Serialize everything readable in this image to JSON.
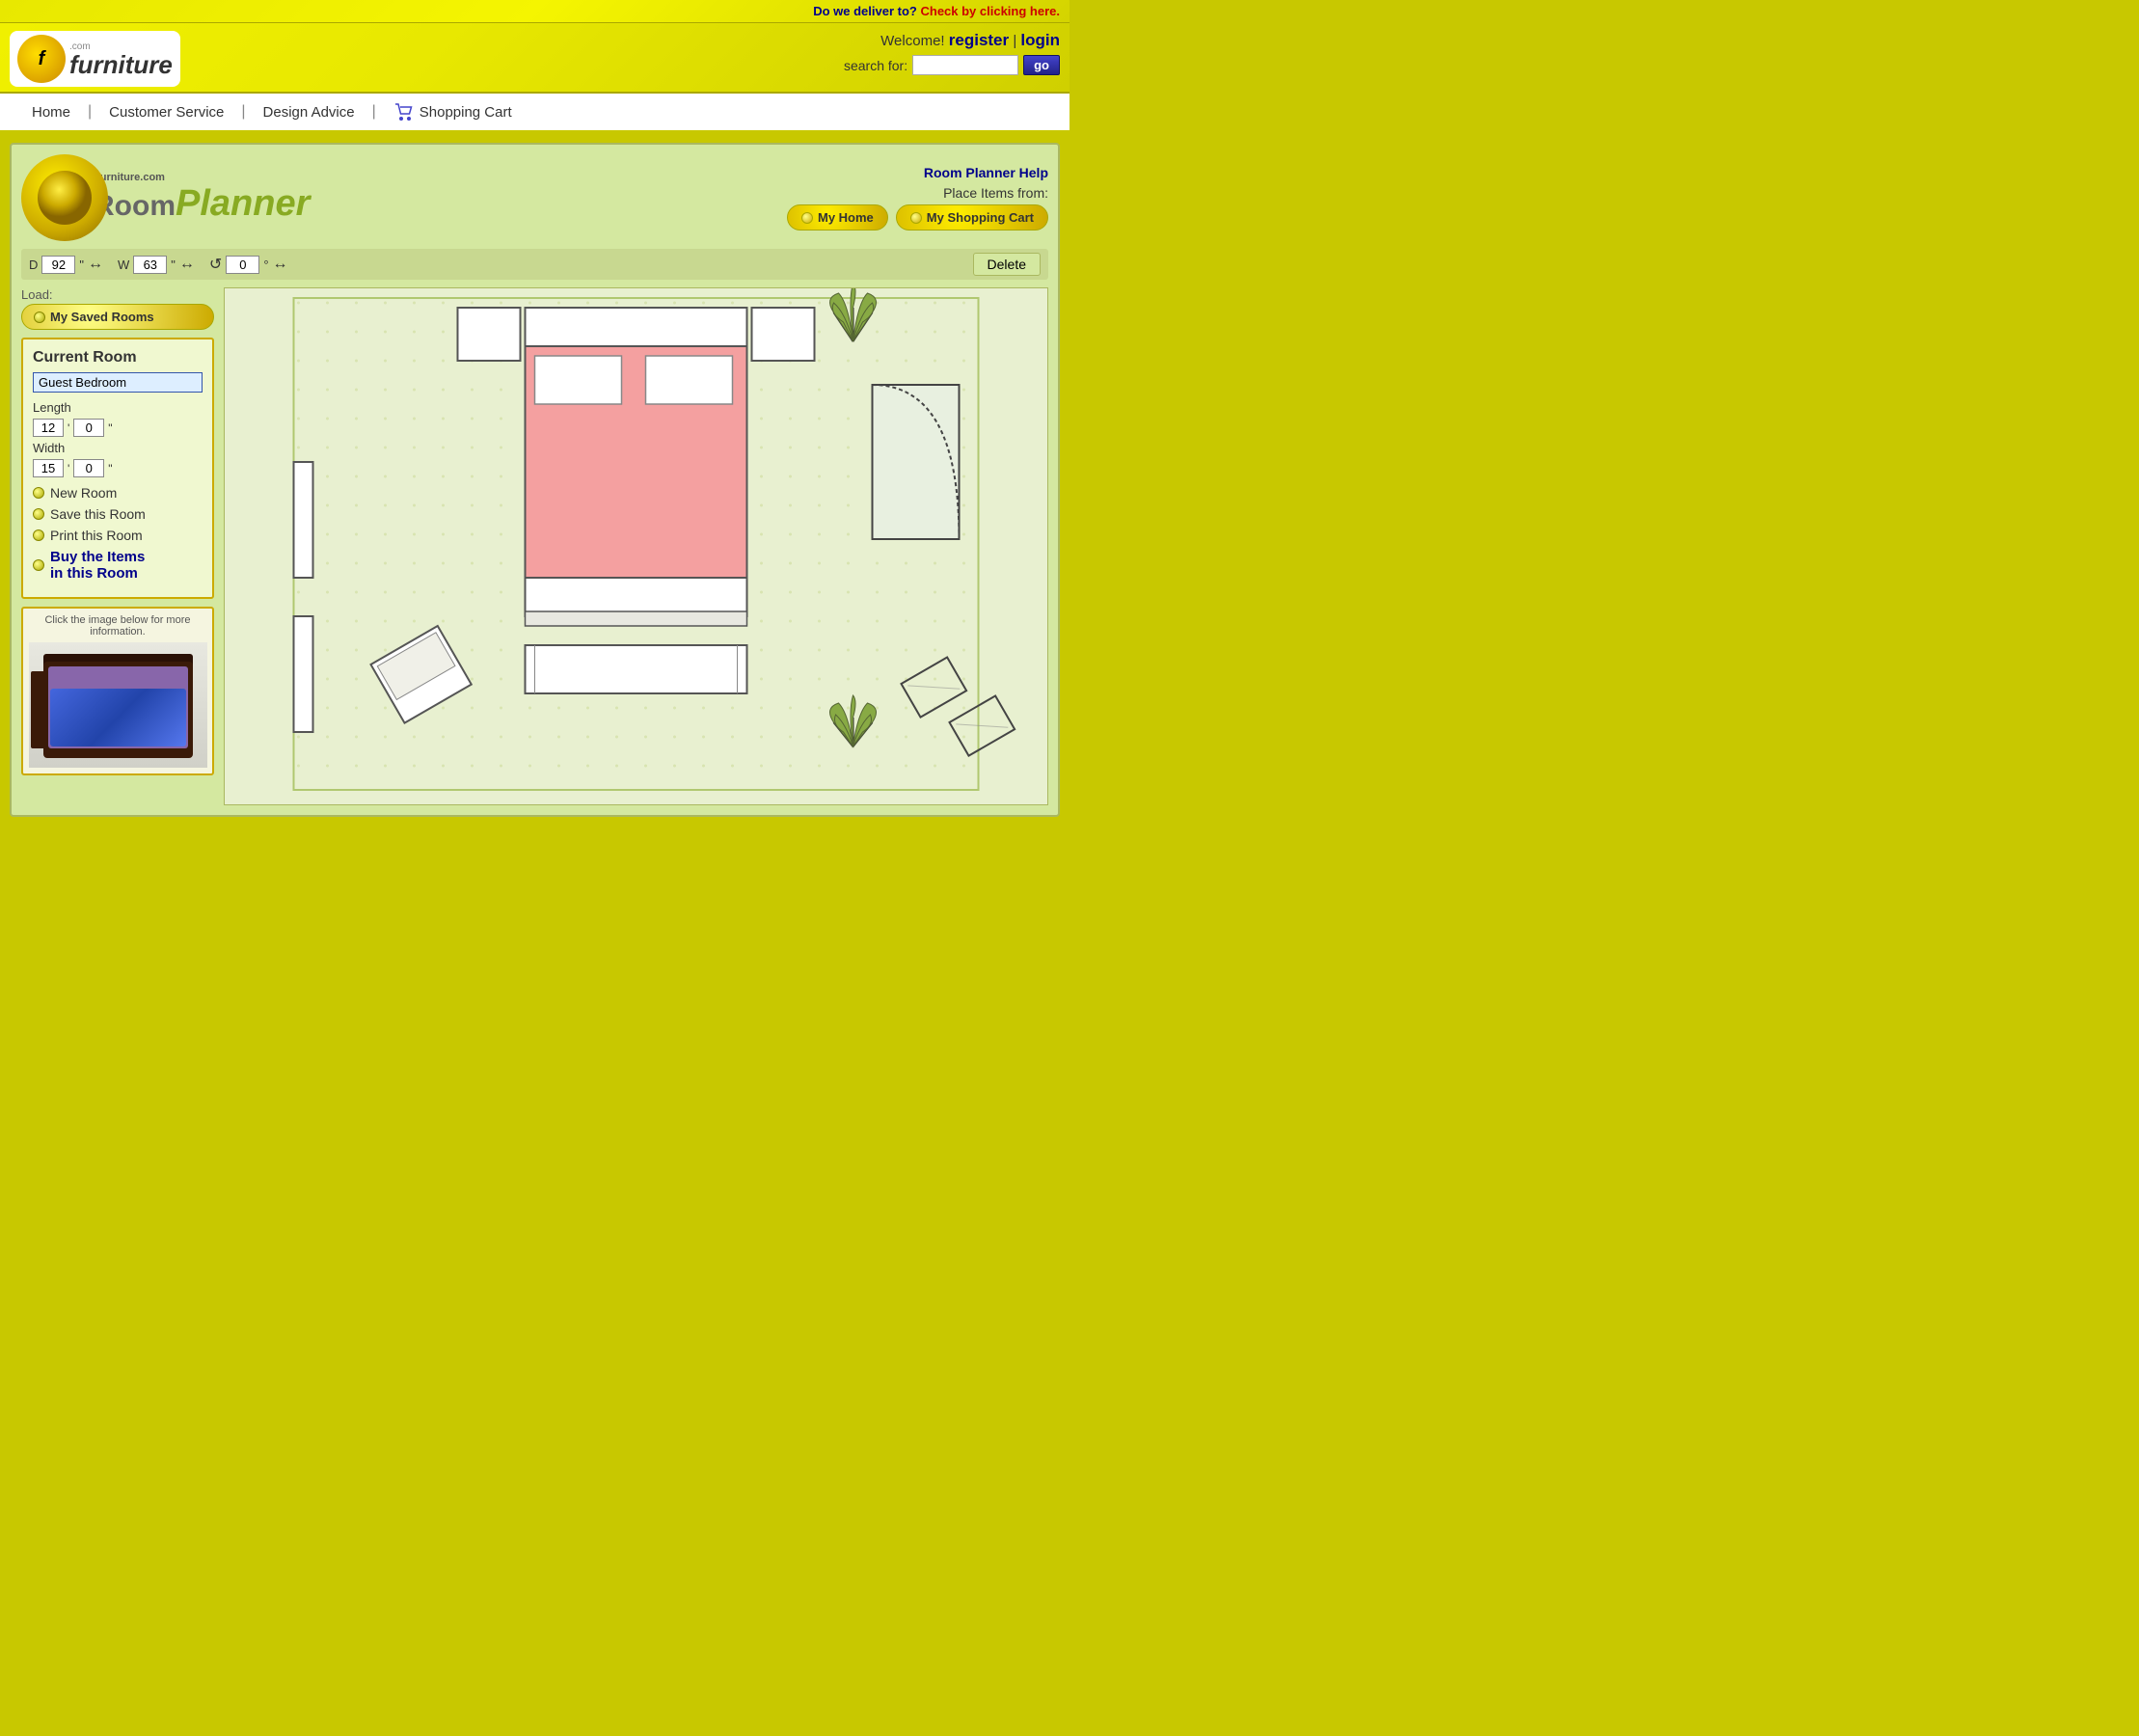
{
  "delivery_bar": {
    "question": "Do we deliver to?",
    "link_text": "Check by clicking here."
  },
  "header": {
    "logo_letter": "f",
    "logo_name": "furniture",
    "logo_com": ".com",
    "welcome": "Welcome!",
    "register": "register",
    "separator": "|",
    "login": "login",
    "search_label": "search for:",
    "search_placeholder": "",
    "go_button": "go"
  },
  "nav": {
    "home": "Home",
    "customer_service": "Customer Service",
    "design_advice": "Design Advice",
    "shopping_cart": "Shopping Cart"
  },
  "room_planner": {
    "help_link": "Room Planner Help",
    "logo_fcom": "Furniture.com",
    "logo_room": "Room",
    "logo_planner": "Planner",
    "place_label": "Place Items from:",
    "my_home_btn": "My Home",
    "my_shopping_cart_btn": "My Shopping Cart",
    "toolbar": {
      "d_label": "D",
      "d_value": "92",
      "d_unit": "\"",
      "w_label": "W",
      "w_value": "63",
      "w_unit": "\"",
      "rotate_value": "0",
      "rotate_unit": "°",
      "delete_label": "Delete"
    },
    "load_label": "Load:",
    "my_saved_rooms": "My Saved Rooms",
    "current_room": {
      "title": "Current Room",
      "name": "Guest Bedroom",
      "length_label": "Length",
      "length_ft": "12",
      "length_in": "0",
      "width_label": "Width",
      "width_ft": "15",
      "width_in": "0",
      "new_room": "New Room",
      "save_room": "Save this Room",
      "print_room": "Print this Room",
      "buy_items_line1": "Buy the Items",
      "buy_items_line2": "in this Room"
    },
    "product_box": {
      "label": "Click the image below for more information."
    }
  }
}
